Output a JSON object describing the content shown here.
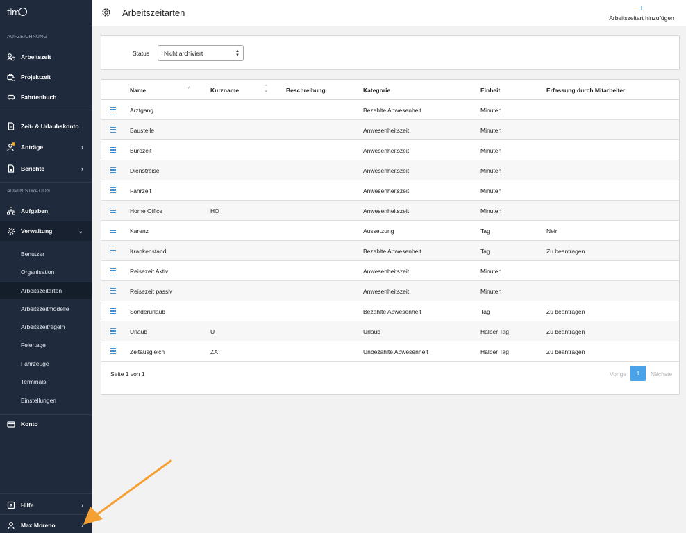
{
  "app": {
    "logo_text": "tim"
  },
  "sidebar": {
    "section_recording": "AUFZEICHNUNG",
    "section_admin": "ADMINISTRATION",
    "items_recording": [
      {
        "label": "Arbeitszeit",
        "icon": "clock-user-icon"
      },
      {
        "label": "Projektzeit",
        "icon": "briefcase-clock-icon"
      },
      {
        "label": "Fahrtenbuch",
        "icon": "car-icon"
      }
    ],
    "items_accounts": [
      {
        "label": "Zeit- & Urlaubskonto",
        "icon": "document-icon"
      },
      {
        "label": "Anträge",
        "icon": "user-request-icon"
      },
      {
        "label": "Berichte",
        "icon": "report-icon"
      }
    ],
    "items_admin": [
      {
        "label": "Aufgaben",
        "icon": "hierarchy-icon"
      },
      {
        "label": "Verwaltung",
        "icon": "gear-icon"
      }
    ],
    "sub_items": [
      "Benutzer",
      "Organisation",
      "Arbeitszeitarten",
      "Arbeitszeitmodelle",
      "Arbeitszeitregeln",
      "Feiertage",
      "Fahrzeuge",
      "Terminals",
      "Einstellungen"
    ],
    "konto": "Konto",
    "help": "Hilfe",
    "user": "Max Moreno"
  },
  "header": {
    "title": "Arbeitszeitarten",
    "add_label": "Arbeitszeitart hinzufügen",
    "add_icon": "+"
  },
  "filter": {
    "status_label": "Status",
    "status_value": "Nicht archiviert"
  },
  "table": {
    "columns": [
      "Name",
      "Kurzname",
      "Beschreibung",
      "Kategorie",
      "Einheit",
      "Erfassung durch Mitarbeiter"
    ],
    "rows": [
      [
        "Arztgang",
        "",
        "",
        "Bezahlte Abwesenheit",
        "Minuten",
        ""
      ],
      [
        "Baustelle",
        "",
        "",
        "Anwesenheitszeit",
        "Minuten",
        ""
      ],
      [
        "Bürozeit",
        "",
        "",
        "Anwesenheitszeit",
        "Minuten",
        ""
      ],
      [
        "Dienstreise",
        "",
        "",
        "Anwesenheitszeit",
        "Minuten",
        ""
      ],
      [
        "Fahrzeit",
        "",
        "",
        "Anwesenheitszeit",
        "Minuten",
        ""
      ],
      [
        "Home Office",
        "HO",
        "",
        "Anwesenheitszeit",
        "Minuten",
        ""
      ],
      [
        "Karenz",
        "",
        "",
        "Aussetzung",
        "Tag",
        "Nein"
      ],
      [
        "Krankenstand",
        "",
        "",
        "Bezahlte Abwesenheit",
        "Tag",
        "Zu beantragen"
      ],
      [
        "Reisezeit Aktiv",
        "",
        "",
        "Anwesenheitszeit",
        "Minuten",
        ""
      ],
      [
        "Reisezeit passiv",
        "",
        "",
        "Anwesenheitszeit",
        "Minuten",
        ""
      ],
      [
        "Sonderurlaub",
        "",
        "",
        "Bezahlte Abwesenheit",
        "Tag",
        "Zu beantragen"
      ],
      [
        "Urlaub",
        "U",
        "",
        "Urlaub",
        "Halber Tag",
        "Zu beantragen"
      ],
      [
        "Zeitausgleich",
        "ZA",
        "",
        "Unbezahlte Abwesenheit",
        "Halber Tag",
        "Zu beantragen"
      ]
    ]
  },
  "pagination": {
    "info": "Seite 1 von 1",
    "prev": "Vorige",
    "current": "1",
    "next": "Nächste"
  },
  "colors": {
    "sidebar": "#1f2b3d",
    "accent": "#3a8fd9",
    "arrow": "#f5a033"
  }
}
